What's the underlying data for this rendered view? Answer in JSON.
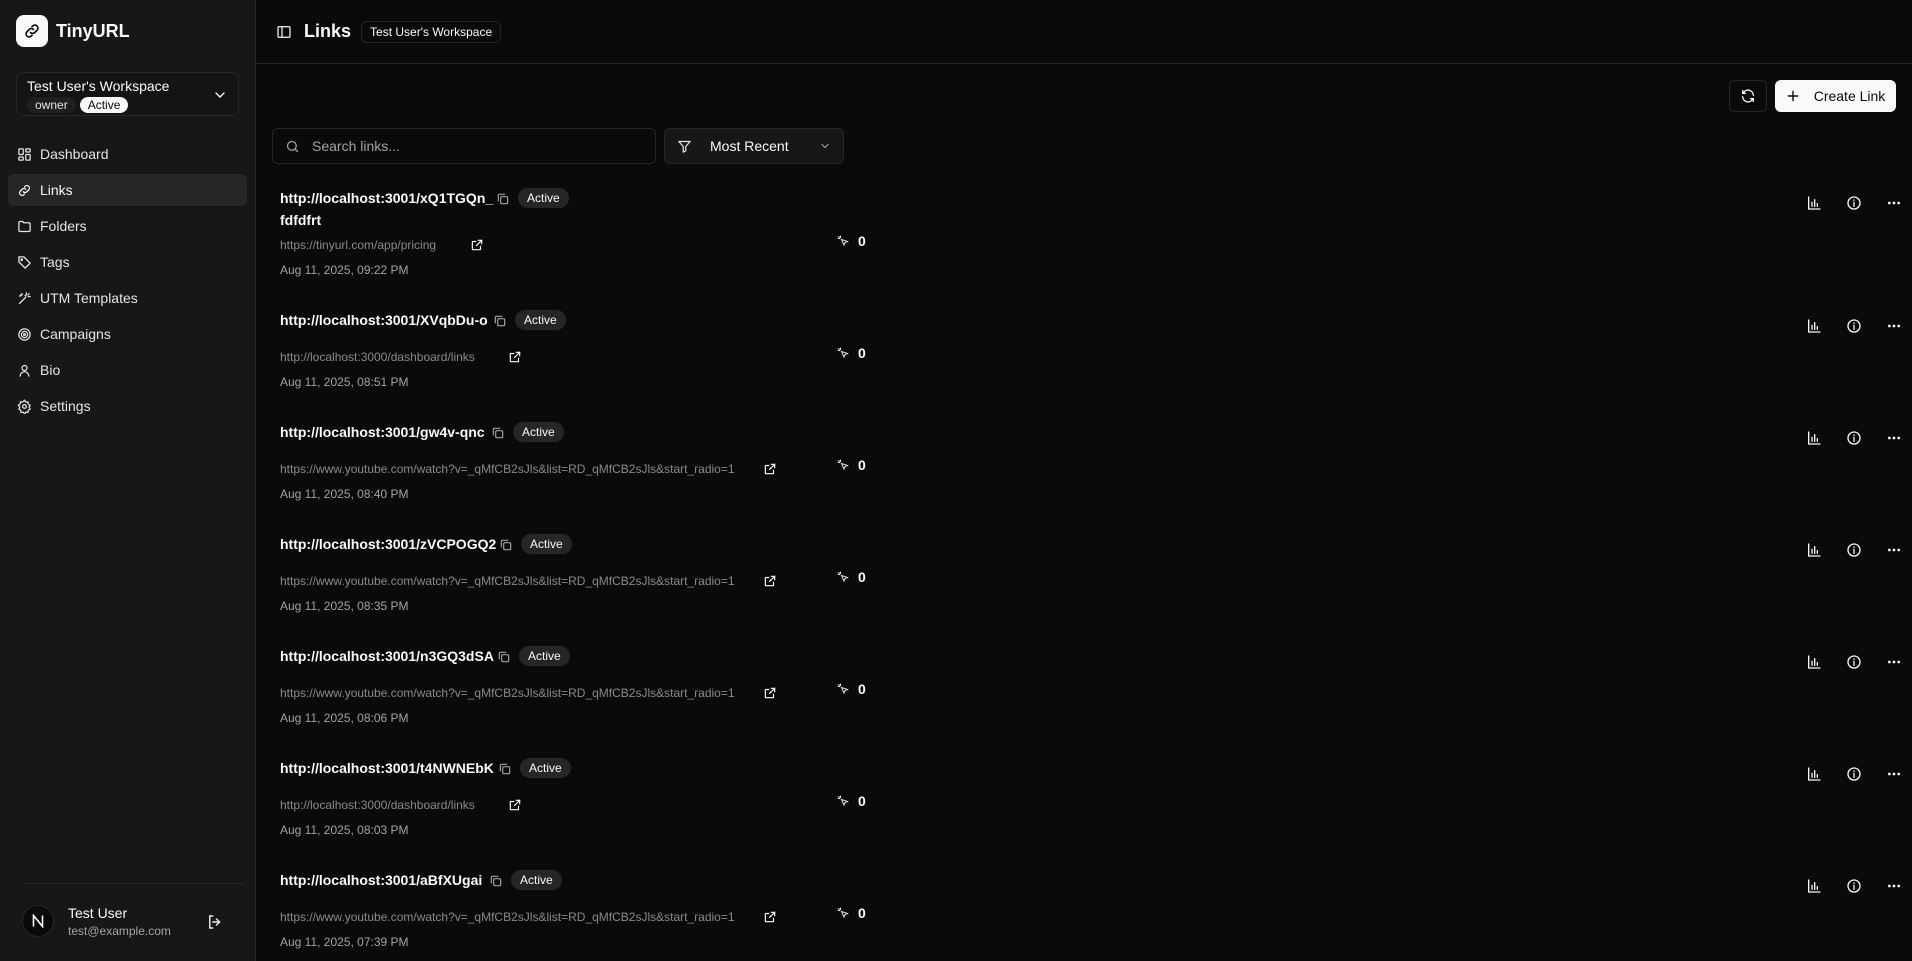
{
  "app": {
    "name": "TinyURL",
    "page_title": "Links",
    "workspace_pill": "Test User's Workspace"
  },
  "workspace": {
    "name": "Test User's Workspace",
    "role": "owner",
    "status": "Active"
  },
  "nav": [
    {
      "label": "Dashboard",
      "icon": "dashboard-icon"
    },
    {
      "label": "Links",
      "icon": "link-icon",
      "active": true
    },
    {
      "label": "Folders",
      "icon": "folder-icon"
    },
    {
      "label": "Tags",
      "icon": "tag-icon"
    },
    {
      "label": "UTM Templates",
      "icon": "sparkle-icon"
    },
    {
      "label": "Campaigns",
      "icon": "target-icon"
    },
    {
      "label": "Bio",
      "icon": "user-icon"
    },
    {
      "label": "Settings",
      "icon": "gear-icon"
    }
  ],
  "user": {
    "name": "Test User",
    "email": "test@example.com",
    "avatar_letter": "N"
  },
  "toolbar": {
    "create_label": "Create Link",
    "search_placeholder": "Search links...",
    "sort_value": "Most Recent"
  },
  "colors": {
    "background": "#0a0a0a",
    "sidebar": "#171717",
    "border": "#262626",
    "primary_button": "#fafafa"
  },
  "links": [
    {
      "short_line1": "http://localhost:3001/xQ1TGQn_",
      "short_line2": "fdfdfrt",
      "status": "Active",
      "destination": "https://tinyurl.com/app/pricing",
      "date": "Aug 11, 2025, 09:22 PM",
      "clicks": "0"
    },
    {
      "short": "http://localhost:3001/XVqbDu-o",
      "status": "Active",
      "destination": "http://localhost:3000/dashboard/links",
      "date": "Aug 11, 2025, 08:51 PM",
      "clicks": "0"
    },
    {
      "short": "http://localhost:3001/gw4v-qnc",
      "status": "Active",
      "destination": "https://www.youtube.com/watch?v=_qMfCB2sJls&list=RD_qMfCB2sJls&start_radio=1",
      "date": "Aug 11, 2025, 08:40 PM",
      "clicks": "0"
    },
    {
      "short": "http://localhost:3001/zVCPOGQ2",
      "status": "Active",
      "destination": "https://www.youtube.com/watch?v=_qMfCB2sJls&list=RD_qMfCB2sJls&start_radio=1",
      "date": "Aug 11, 2025, 08:35 PM",
      "clicks": "0"
    },
    {
      "short": "http://localhost:3001/n3GQ3dSA",
      "status": "Active",
      "destination": "https://www.youtube.com/watch?v=_qMfCB2sJls&list=RD_qMfCB2sJls&start_radio=1",
      "date": "Aug 11, 2025, 08:06 PM",
      "clicks": "0"
    },
    {
      "short": "http://localhost:3001/t4NWNEbK",
      "status": "Active",
      "destination": "http://localhost:3000/dashboard/links",
      "date": "Aug 11, 2025, 08:03 PM",
      "clicks": "0"
    },
    {
      "short": "http://localhost:3001/aBfXUgai",
      "status": "Active",
      "destination": "https://www.youtube.com/watch?v=_qMfCB2sJls&list=RD_qMfCB2sJls&start_radio=1",
      "date": "Aug 11, 2025, 07:39 PM",
      "clicks": "0"
    }
  ]
}
